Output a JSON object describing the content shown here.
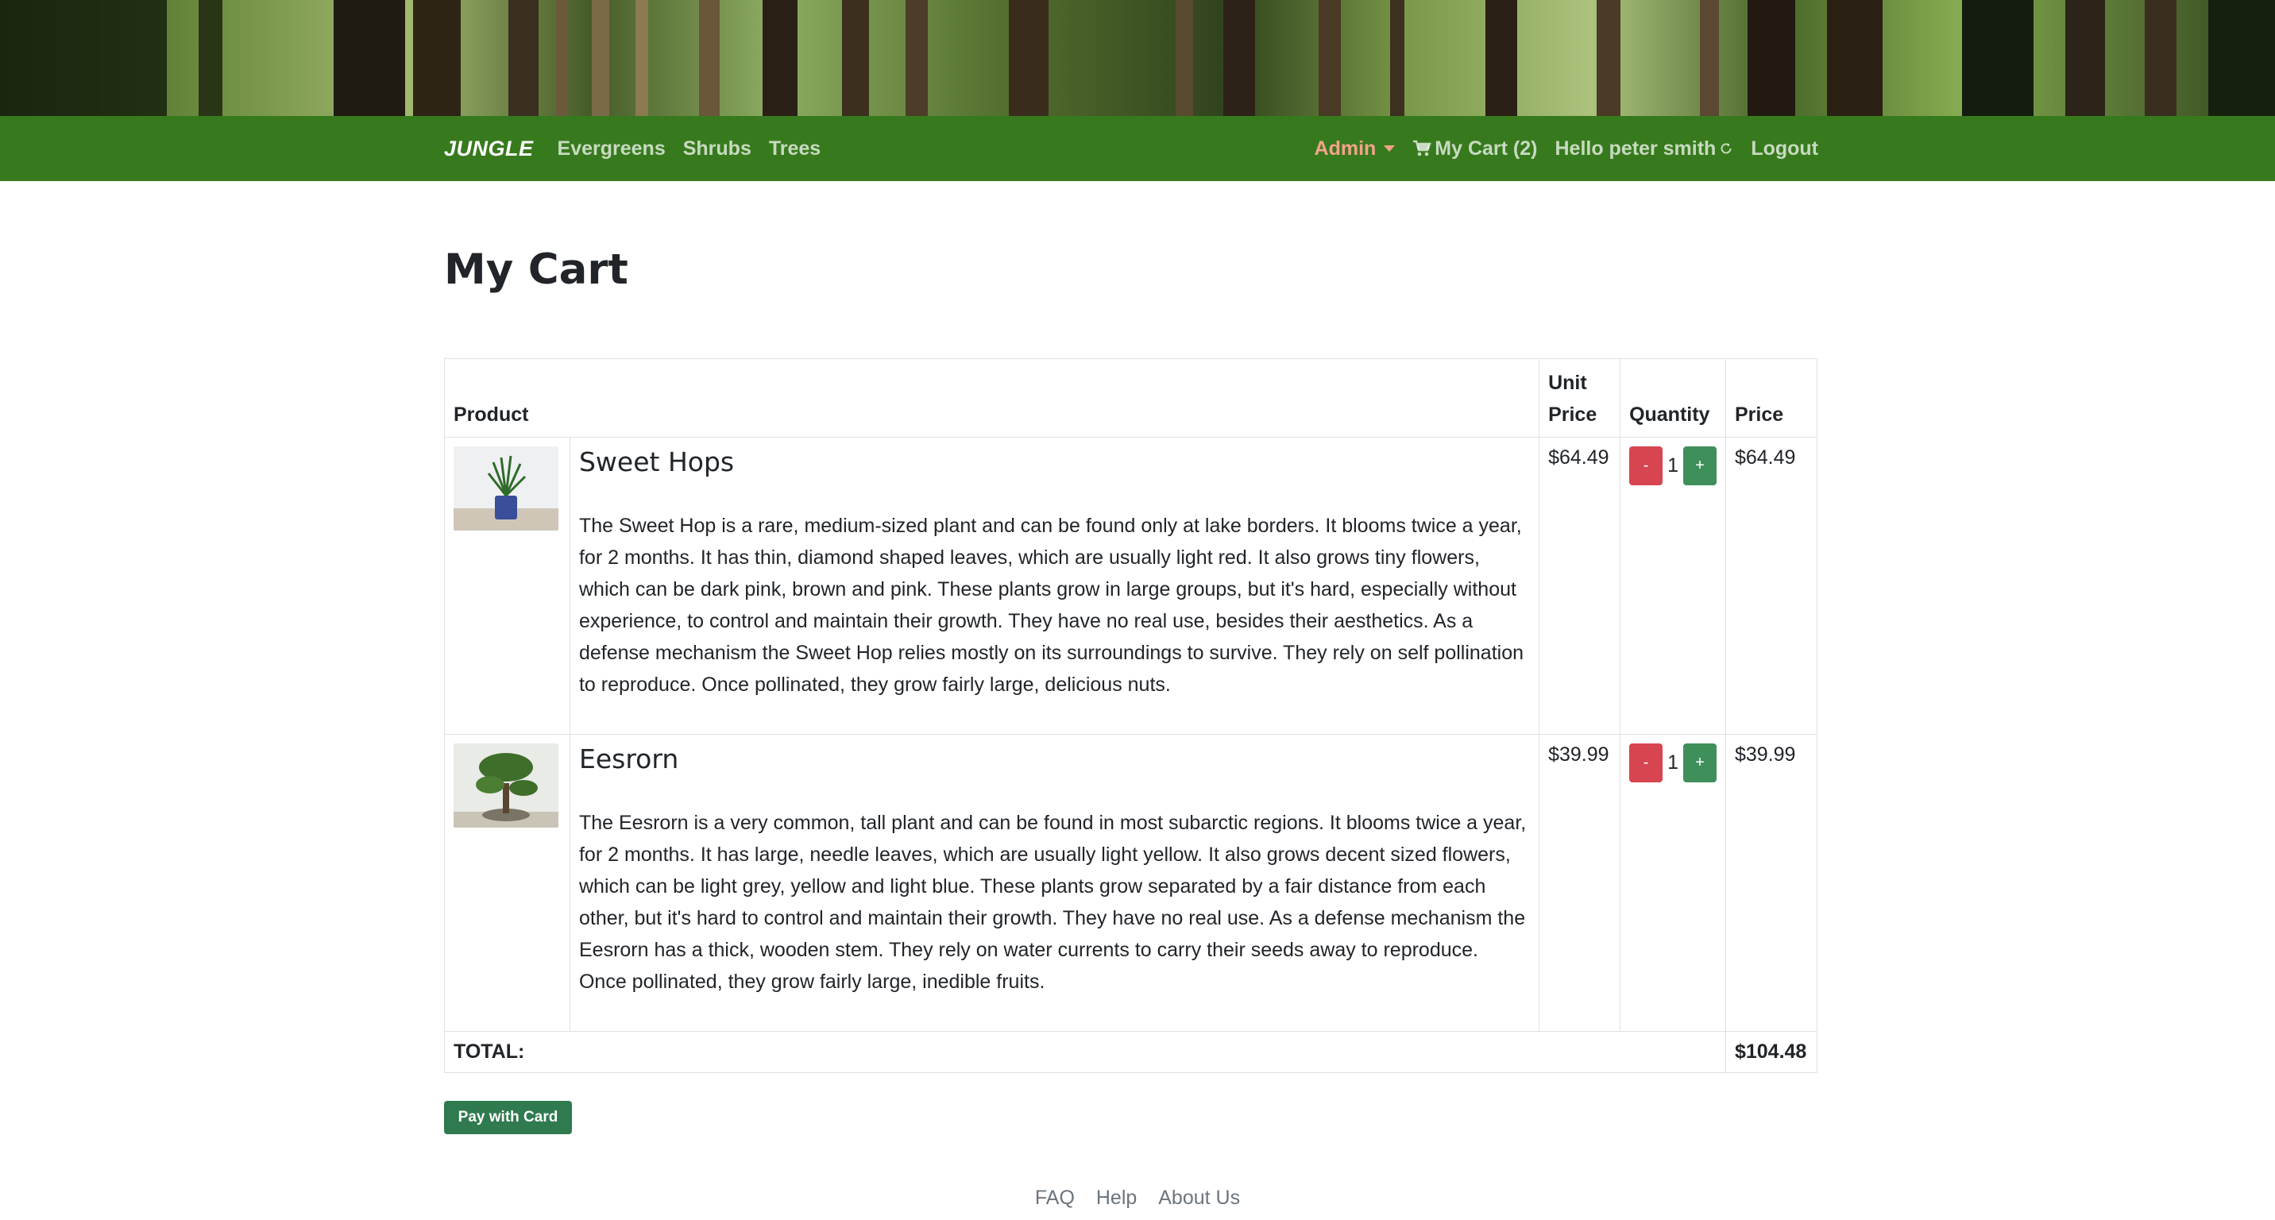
{
  "nav": {
    "brand": "JUNGLE",
    "links": [
      "Evergreens",
      "Shrubs",
      "Trees"
    ],
    "admin_label": "Admin",
    "cart_label": "My Cart (2)",
    "greeting": "Hello peter smith",
    "logout_label": "Logout"
  },
  "page_title": "My Cart",
  "table": {
    "headers": {
      "product": "Product",
      "unit_price": "Unit Price",
      "quantity": "Quantity",
      "price": "Price"
    },
    "items": [
      {
        "name": "Sweet Hops",
        "description": "The Sweet Hop is a rare, medium-sized plant and can be found only at lake borders. It blooms twice a year, for 2 months. It has thin, diamond shaped leaves, which are usually light red. It also grows tiny flowers, which can be dark pink, brown and pink. These plants grow in large groups, but it's hard, especially without experience, to control and maintain their growth. They have no real use, besides their aesthetics. As a defense mechanism the Sweet Hop relies mostly on its surroundings to survive. They rely on self pollination to reproduce. Once pollinated, they grow fairly large, delicious nuts.",
        "unit_price": "$64.49",
        "quantity": "1",
        "price": "$64.49",
        "minus": "-",
        "plus": "+"
      },
      {
        "name": "Eesrorn",
        "description": "The Eesrorn is a very common, tall plant and can be found in most subarctic regions. It blooms twice a year, for 2 months. It has large, needle leaves, which are usually light yellow. It also grows decent sized flowers, which can be light grey, yellow and light blue. These plants grow separated by a fair distance from each other, but it's hard to control and maintain their growth. They have no real use. As a defense mechanism the Eesrorn has a thick, wooden stem. They rely on water currents to carry their seeds away to reproduce. Once pollinated, they grow fairly large, inedible fruits.",
        "unit_price": "$39.99",
        "quantity": "1",
        "price": "$39.99",
        "minus": "-",
        "plus": "+"
      }
    ],
    "total_label": "TOTAL:",
    "total_value": "$104.48"
  },
  "pay_button": "Pay with Card",
  "footer": {
    "links": [
      "FAQ",
      "Help",
      "About Us"
    ]
  },
  "colors": {
    "navbar": "#377a1d",
    "minus_button": "#d64550",
    "plus_button": "#3f8f5a",
    "pay_button": "#2f7a4f",
    "admin_link": "#f5a38a"
  },
  "icons": {
    "cart": "shopping-cart-icon",
    "greeting": "refresh-icon",
    "admin": "caret-down-icon"
  }
}
